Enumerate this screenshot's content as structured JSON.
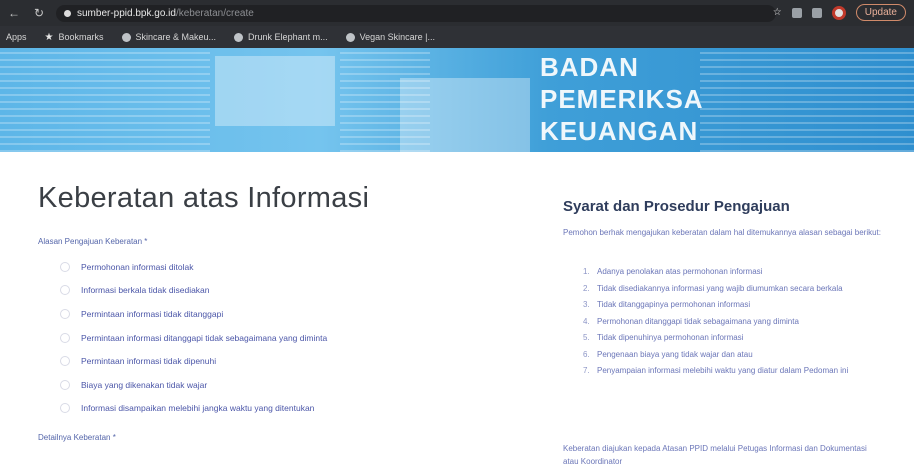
{
  "browser": {
    "url_host": "sumber-ppid.bpk.go.id",
    "url_path": "/keberatan/create",
    "update_label": "Update",
    "bookmarks": [
      {
        "label": "Apps"
      },
      {
        "label": "Bookmarks"
      },
      {
        "label": "Skincare & Makeu..."
      },
      {
        "label": "Drunk Elephant m..."
      },
      {
        "label": "Vegan Skincare |..."
      }
    ]
  },
  "banner": {
    "words": [
      "BADAN",
      "PEMERIKSA",
      "KEUANGAN"
    ]
  },
  "form": {
    "title": "Keberatan atas Informasi",
    "reason_label": "Alasan Pengajuan Keberatan *",
    "options": [
      "Permohonan informasi ditolak",
      "Informasi berkala tidak disediakan",
      "Permintaan informasi tidak ditanggapi",
      "Permintaan informasi ditanggapi tidak sebagaimana yang diminta",
      "Permintaan informasi tidak dipenuhi",
      "Biaya yang dikenakan tidak wajar",
      "Informasi disampaikan melebihi jangka waktu yang ditentukan"
    ],
    "detail_label": "Detailnya Keberatan *"
  },
  "sidebar": {
    "title": "Syarat dan Prosedur Pengajuan",
    "intro": "Pemohon berhak mengajukan keberatan dalam hal ditemukannya alasan sebagai berikut:",
    "items": [
      "Adanya penolakan atas permohonan informasi",
      "Tidak disediakannya informasi yang wajib diumumkan secara berkala",
      "Tidak ditanggapinya permohonan informasi",
      "Permohonan ditanggapi tidak sebagaimana yang diminta",
      "Tidak dipenuhinya permohonan informasi",
      "Pengenaan biaya yang tidak wajar dan atau",
      "Penyampaian informasi melebihi waktu yang diatur dalam Pedoman ini"
    ],
    "footer": "Keberatan diajukan kepada Atasan PPID melalui Petugas Informasi dan Dokumentasi atau Koordinator"
  }
}
